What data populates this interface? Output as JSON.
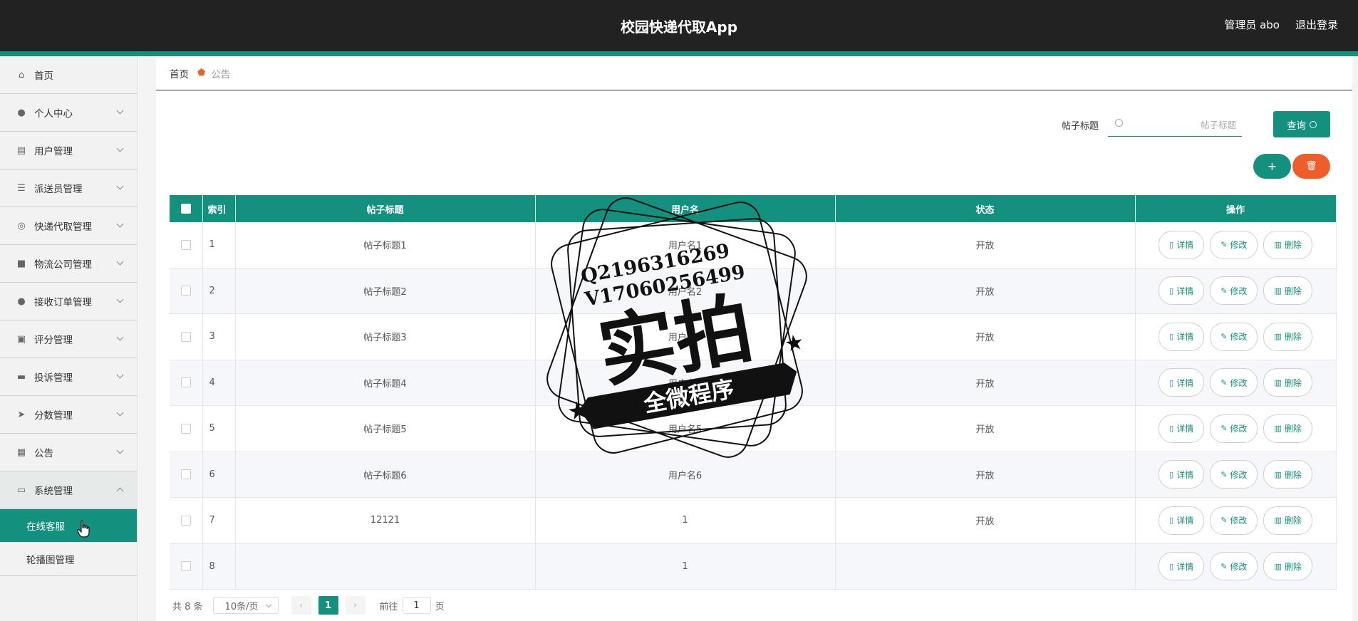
{
  "header": {
    "title": "校园快递代取App",
    "user": "管理员 abo",
    "logout": "退出登录"
  },
  "sidebar": {
    "items": [
      {
        "label": "首页",
        "icon": "home-icon"
      },
      {
        "label": "个人中心",
        "icon": "user-icon"
      },
      {
        "label": "用户管理",
        "icon": "chart-icon"
      },
      {
        "label": "派送员管理",
        "icon": "list-icon"
      },
      {
        "label": "快递代取管理",
        "icon": "globe-icon"
      },
      {
        "label": "物流公司管理",
        "icon": "briefcase-icon"
      },
      {
        "label": "接收订单管理",
        "icon": "location-icon"
      },
      {
        "label": "评分管理",
        "icon": "clipboard-icon"
      },
      {
        "label": "投诉管理",
        "icon": "chat-icon"
      },
      {
        "label": "分数管理",
        "icon": "send-icon"
      },
      {
        "label": "公告",
        "icon": "grid-icon"
      },
      {
        "label": "系统管理",
        "icon": "monitor-icon"
      }
    ],
    "subitems": [
      {
        "label": "在线客服"
      },
      {
        "label": "轮播图管理"
      }
    ]
  },
  "breadcrumb": {
    "home": "首页",
    "current": "公告"
  },
  "search": {
    "label": "帖子标题",
    "placeholder": "帖子标题",
    "button": "查询"
  },
  "actions": {
    "add": "+",
    "delete": "🗑"
  },
  "table": {
    "headers": [
      "索引",
      "帖子标题",
      "用户名",
      "状态",
      "操作"
    ],
    "ops": {
      "detail": "详情",
      "edit": "修改",
      "delete": "删除"
    },
    "rows": [
      {
        "index": "1",
        "title": "帖子标题1",
        "username": "用户名1",
        "status": "开放"
      },
      {
        "index": "2",
        "title": "帖子标题2",
        "username": "用户名2",
        "status": "开放"
      },
      {
        "index": "3",
        "title": "帖子标题3",
        "username": "用户名3",
        "status": "开放"
      },
      {
        "index": "4",
        "title": "帖子标题4",
        "username": "用户名4",
        "status": "开放"
      },
      {
        "index": "5",
        "title": "帖子标题5",
        "username": "用户名5",
        "status": "开放"
      },
      {
        "index": "6",
        "title": "帖子标题6",
        "username": "用户名6",
        "status": "开放"
      },
      {
        "index": "7",
        "title": "12121",
        "username": "1",
        "status": "开放"
      },
      {
        "index": "8",
        "title": "",
        "username": "1",
        "status": ""
      }
    ]
  },
  "pagination": {
    "total": "共 8 条",
    "page_size": "10条/页",
    "current": "1",
    "goto_label": "前往",
    "goto_value": "1",
    "page_suffix": "页"
  },
  "watermark": {
    "line1": "Q2196316269",
    "line2": "V17060256499",
    "main": "实拍",
    "banner": "全微程序"
  },
  "colors": {
    "primary": "#14907e",
    "danger": "#ef5d2a",
    "header": "#222222"
  }
}
